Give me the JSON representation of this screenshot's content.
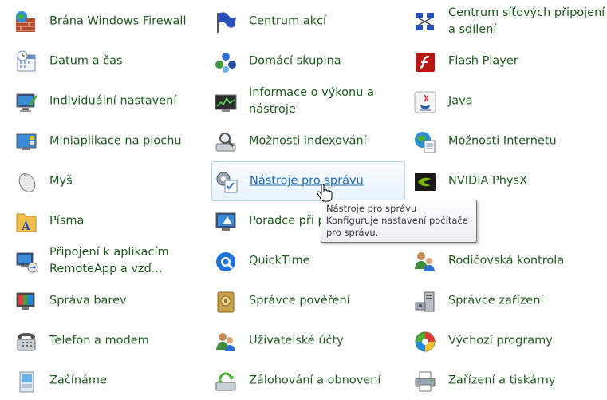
{
  "items": [
    {
      "id": "firewall",
      "label": "Brána Windows Firewall",
      "icon": "firewall-icon"
    },
    {
      "id": "action-center",
      "label": "Centrum akcí",
      "icon": "flag-icon"
    },
    {
      "id": "network-center",
      "label": "Centrum síťových připojení a sdílení",
      "icon": "network-icon"
    },
    {
      "id": "datetime",
      "label": "Datum a čas",
      "icon": "calendar-clock-icon"
    },
    {
      "id": "homegroup",
      "label": "Domácí skupina",
      "icon": "homegroup-icon"
    },
    {
      "id": "flash",
      "label": "Flash Player",
      "icon": "flash-icon"
    },
    {
      "id": "personalization",
      "label": "Individuální nastavení",
      "icon": "monitor-paint-icon"
    },
    {
      "id": "performance",
      "label": "Informace o výkonu a nástroje",
      "icon": "performance-icon"
    },
    {
      "id": "java",
      "label": "Java",
      "icon": "java-icon"
    },
    {
      "id": "gadgets",
      "label": "Miniaplikace na plochu",
      "icon": "gadgets-icon"
    },
    {
      "id": "indexing",
      "label": "Možnosti indexování",
      "icon": "indexing-icon"
    },
    {
      "id": "internet-options",
      "label": "Možnosti Internetu",
      "icon": "globe-icon"
    },
    {
      "id": "mouse",
      "label": "Myš",
      "icon": "mouse-icon"
    },
    {
      "id": "admin-tools",
      "label": "Nástroje pro správu",
      "icon": "admin-tools-icon"
    },
    {
      "id": "physx",
      "label": "NVIDIA PhysX",
      "icon": "nvidia-icon"
    },
    {
      "id": "fonts",
      "label": "Písma",
      "icon": "fonts-folder-icon"
    },
    {
      "id": "troubleshooting",
      "label": "Poradce při p",
      "icon": "troubleshoot-icon"
    },
    {
      "id": "blank",
      "label": "",
      "icon": ""
    },
    {
      "id": "remoteapp",
      "label": "Připojení k aplikacím RemoteApp a vzd...",
      "icon": "remoteapp-icon"
    },
    {
      "id": "quicktime",
      "label": "QuickTime",
      "icon": "quicktime-icon"
    },
    {
      "id": "parental",
      "label": "Rodičovská kontrola",
      "icon": "parental-icon"
    },
    {
      "id": "color",
      "label": "Správa barev",
      "icon": "color-management-icon"
    },
    {
      "id": "credentials",
      "label": "Správce pověření",
      "icon": "vault-icon"
    },
    {
      "id": "device-manager",
      "label": "Správce zařízení",
      "icon": "device-manager-icon"
    },
    {
      "id": "phone-modem",
      "label": "Telefon a modem",
      "icon": "phone-icon"
    },
    {
      "id": "user-accounts",
      "label": "Uživatelské účty",
      "icon": "users-icon"
    },
    {
      "id": "default-programs",
      "label": "Výchozí programy",
      "icon": "default-programs-icon"
    },
    {
      "id": "getting-started",
      "label": "Začínáme",
      "icon": "getting-started-icon"
    },
    {
      "id": "backup",
      "label": "Zálohování a obnovení",
      "icon": "backup-icon"
    },
    {
      "id": "devices-printers",
      "label": "Zařízení a tiskárny",
      "icon": "printer-icon"
    }
  ],
  "tooltip": {
    "title": "Nástroje pro správu",
    "description": "Konfiguruje nastavení počítače pro správu."
  },
  "colors": {
    "link": "#1e5c1e",
    "hover_link": "#1e6fc6"
  }
}
